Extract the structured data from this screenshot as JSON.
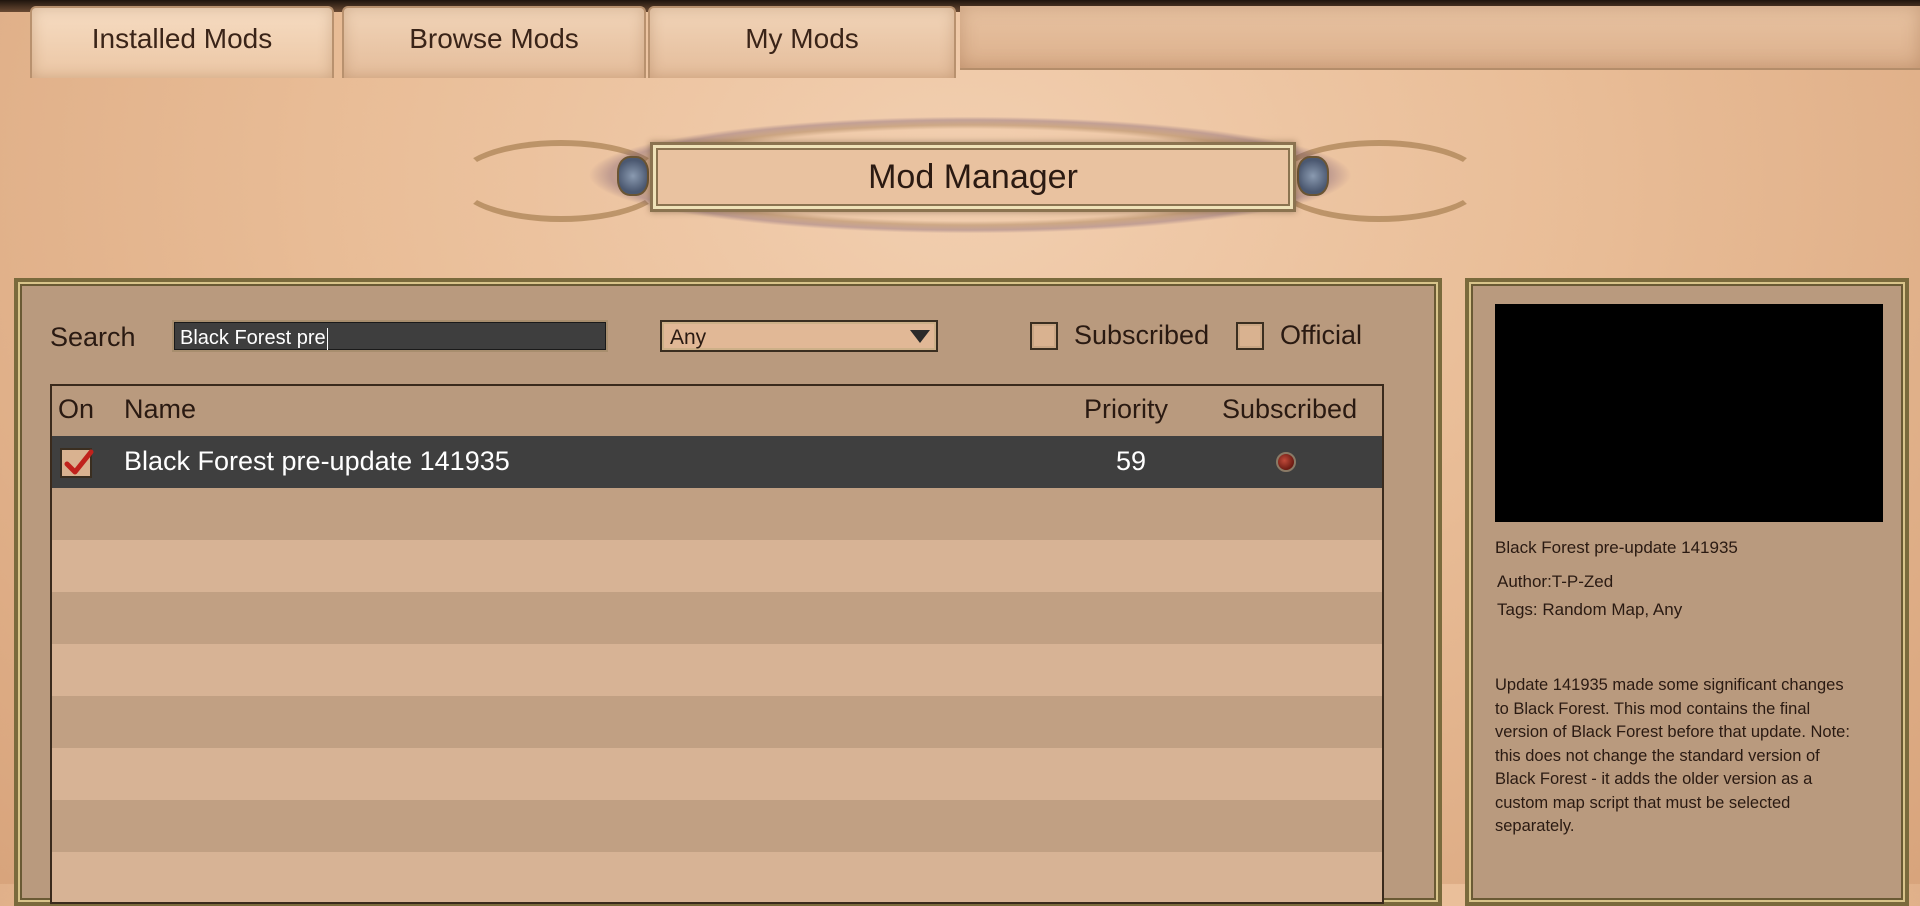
{
  "tabs": [
    {
      "label": "Installed Mods"
    },
    {
      "label": "Browse Mods"
    },
    {
      "label": "My Mods"
    }
  ],
  "title": "Mod Manager",
  "filters": {
    "search_label": "Search",
    "search_value": "Black Forest pre",
    "dropdown_value": "Any",
    "subscribed_label": "Subscribed",
    "official_label": "Official"
  },
  "table": {
    "columns": [
      "On",
      "Name",
      "Priority",
      "Subscribed"
    ],
    "rows": [
      {
        "on": true,
        "name": "Black Forest pre-update 141935",
        "priority": "59",
        "subscribed": true
      }
    ]
  },
  "details": {
    "name": "Black Forest pre-update 141935",
    "author": "Author:T-P-Zed",
    "tags": "Tags: Random Map, Any",
    "description": "Update 141935 made some significant changes to Black Forest. This mod contains the final version of Black Forest before that update. Note: this does not change the standard version of Black Forest - it adds the older version as a custom map script that must be selected separately."
  },
  "colors": {
    "selected_row": "#3f3f3f",
    "check_mark": "#c0221c",
    "panel": "#b99a7e"
  }
}
